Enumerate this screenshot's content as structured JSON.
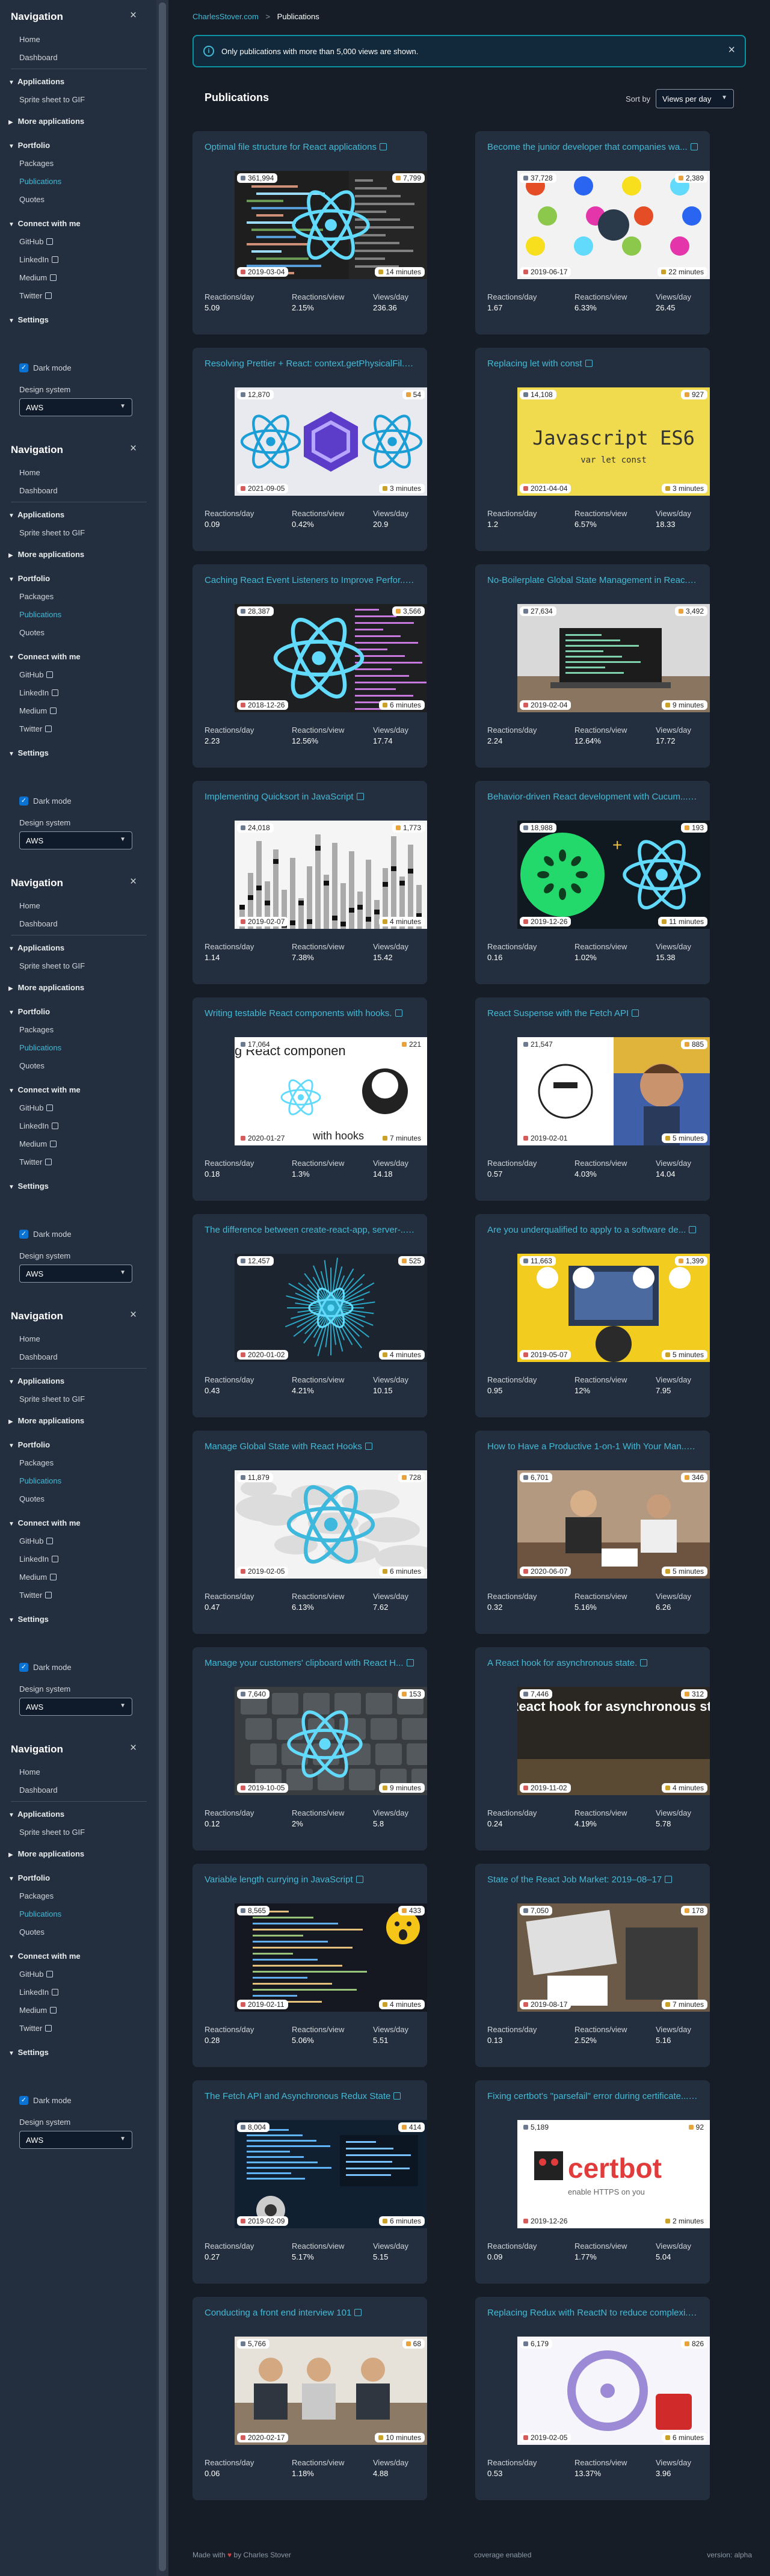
{
  "breadcrumb": {
    "site": "CharlesStover.com",
    "current": "Publications"
  },
  "flash": {
    "text": "Only publications with more than 5,000 views are shown.",
    "close": "×"
  },
  "header": {
    "title": "Publications",
    "sort_label": "Sort by",
    "sort_value": "Views per day"
  },
  "nav": {
    "title": "Navigation",
    "close": "×",
    "home": "Home",
    "dashboard": "Dashboard",
    "applications": "Applications",
    "sprite": "Sprite sheet to GIF",
    "more_apps": "More applications",
    "portfolio": "Portfolio",
    "packages": "Packages",
    "publications": "Publications",
    "quotes": "Quotes",
    "connect": "Connect with me",
    "github": "GitHub",
    "linkedin": "LinkedIn",
    "medium": "Medium",
    "twitter": "Twitter",
    "settings": "Settings",
    "dark_mode": "Dark mode",
    "design_system": "Design system",
    "design_value": "AWS"
  },
  "labels": {
    "per_day": "Reactions/day",
    "per_view": "Reactions/view",
    "views_day": "Views/day"
  },
  "cards": [
    {
      "title": "Optimal file structure for React applications",
      "views": "361,994",
      "reactions": "7,799",
      "date": "2019-03-04",
      "minutes": "14 minutes",
      "rpd": "5.09",
      "rpv": "2.15%",
      "vpd": "236.36",
      "art": "code"
    },
    {
      "title": "Become the junior developer that companies wa...",
      "views": "37,728",
      "reactions": "2,389",
      "date": "2019-06-17",
      "minutes": "22 minutes",
      "rpd": "1.67",
      "rpv": "6.33%",
      "vpd": "26.45",
      "art": "junior"
    },
    {
      "title": "Resolving Prettier + React: context.getPhysicalFil...",
      "views": "12,870",
      "reactions": "54",
      "date": "2021-09-05",
      "minutes": "3 minutes",
      "rpd": "0.09",
      "rpv": "0.42%",
      "vpd": "20.9",
      "art": "prettier"
    },
    {
      "title": "Replacing let with const",
      "views": "14,108",
      "reactions": "927",
      "date": "2021-04-04",
      "minutes": "3 minutes",
      "rpd": "1.2",
      "rpv": "6.57%",
      "vpd": "18.33",
      "art": "es6"
    },
    {
      "title": "Caching React Event Listeners to Improve Perfor...",
      "views": "28,387",
      "reactions": "3,566",
      "date": "2018-12-26",
      "minutes": "6 minutes",
      "rpd": "2.23",
      "rpv": "12.56%",
      "vpd": "17.74",
      "art": "caching"
    },
    {
      "title": "No-Boilerplate Global State Management in Reac...",
      "views": "27,634",
      "reactions": "3,492",
      "date": "2019-02-04",
      "minutes": "9 minutes",
      "rpd": "2.24",
      "rpv": "12.64%",
      "vpd": "17.72",
      "art": "laptop"
    },
    {
      "title": "Implementing Quicksort in JavaScript",
      "views": "24,018",
      "reactions": "1,773",
      "date": "2019-02-07",
      "minutes": "4 minutes",
      "rpd": "1.14",
      "rpv": "7.38%",
      "vpd": "15.42",
      "art": "quicksort"
    },
    {
      "title": "Behavior-driven React development with Cucum...",
      "views": "18,988",
      "reactions": "193",
      "date": "2019-12-26",
      "minutes": "11 minutes",
      "rpd": "0.16",
      "rpv": "1.02%",
      "vpd": "15.38",
      "art": "cucumber"
    },
    {
      "title": "Writing testable React components with hooks.",
      "views": "17,064",
      "reactions": "221",
      "date": "2020-01-27",
      "minutes": "7 minutes",
      "rpd": "0.18",
      "rpv": "1.3%",
      "vpd": "14.18",
      "art": "testable"
    },
    {
      "title": "React Suspense with the Fetch API",
      "views": "21,547",
      "reactions": "885",
      "date": "2019-02-01",
      "minutes": "5 minutes",
      "rpd": "0.57",
      "rpv": "4.03%",
      "vpd": "14.04",
      "art": "suspense"
    },
    {
      "title": "The difference between create-react-app, server-...",
      "views": "12,457",
      "reactions": "525",
      "date": "2020-01-02",
      "minutes": "4 minutes",
      "rpd": "0.43",
      "rpv": "4.21%",
      "vpd": "10.15",
      "art": "burst"
    },
    {
      "title": "Are you underqualified to apply to a software de...",
      "views": "11,663",
      "reactions": "1,399",
      "date": "2019-05-07",
      "minutes": "5 minutes",
      "rpd": "0.95",
      "rpv": "12%",
      "vpd": "7.95",
      "art": "underqual"
    },
    {
      "title": "Manage Global State with React Hooks",
      "views": "11,879",
      "reactions": "728",
      "date": "2019-02-05",
      "minutes": "6 minutes",
      "rpd": "0.47",
      "rpv": "6.13%",
      "vpd": "7.62",
      "art": "globe"
    },
    {
      "title": "How to Have a Productive 1-on-1 With Your Man...",
      "views": "6,701",
      "reactions": "346",
      "date": "2020-06-07",
      "minutes": "5 minutes",
      "rpd": "0.32",
      "rpv": "5.16%",
      "vpd": "6.26",
      "art": "meeting"
    },
    {
      "title": "Manage your customers' clipboard with React H...",
      "views": "7,640",
      "reactions": "153",
      "date": "2019-10-05",
      "minutes": "9 minutes",
      "rpd": "0.12",
      "rpv": "2%",
      "vpd": "5.8",
      "art": "keyboard"
    },
    {
      "title": "A React hook for asynchronous state.",
      "views": "7,446",
      "reactions": "312",
      "date": "2019-11-02",
      "minutes": "4 minutes",
      "rpd": "0.24",
      "rpv": "4.19%",
      "vpd": "5.78",
      "art": "hook",
      "overlay": "A React hook for asynchronous state"
    },
    {
      "title": "Variable length currying in JavaScript",
      "views": "8,565",
      "reactions": "433",
      "date": "2019-02-11",
      "minutes": "4 minutes",
      "rpd": "0.28",
      "rpv": "5.06%",
      "vpd": "5.51",
      "art": "currying"
    },
    {
      "title": "State of the React Job Market: 2019–08–17",
      "views": "7,050",
      "reactions": "178",
      "date": "2019-08-17",
      "minutes": "7 minutes",
      "rpd": "0.13",
      "rpv": "2.52%",
      "vpd": "5.16",
      "art": "desk"
    },
    {
      "title": "The Fetch API and Asynchronous Redux State",
      "views": "8,004",
      "reactions": "414",
      "date": "2019-02-09",
      "minutes": "6 minutes",
      "rpd": "0.27",
      "rpv": "5.17%",
      "vpd": "5.15",
      "art": "servers"
    },
    {
      "title": "Fixing certbot's \"parsefail\" error during certificate...",
      "views": "5,189",
      "reactions": "92",
      "date": "2019-12-26",
      "minutes": "2 minutes",
      "rpd": "0.09",
      "rpv": "1.77%",
      "vpd": "5.04",
      "art": "certbot",
      "logo": "certbot",
      "logo_sub": "enable HTTPS on you"
    },
    {
      "title": "Conducting a front end interview 101",
      "views": "5,766",
      "reactions": "68",
      "date": "2020-02-17",
      "minutes": "10 minutes",
      "rpd": "0.06",
      "rpv": "1.18%",
      "vpd": "4.88",
      "art": "interview"
    },
    {
      "title": "Replacing Redux with ReactN to reduce complexi...",
      "views": "6,179",
      "reactions": "826",
      "date": "2019-02-05",
      "minutes": "6 minutes",
      "rpd": "0.53",
      "rpv": "13.37%",
      "vpd": "3.96",
      "art": "redux"
    }
  ],
  "es6": {
    "title": "Javascript ES6",
    "sub": "var     let     const"
  },
  "testable_text": {
    "top": "g React componen",
    "bottom": "with hooks"
  },
  "footer": {
    "made": "Made with",
    "by": "by Charles Stover",
    "coverage": "coverage enabled",
    "version": "version: alpha"
  },
  "colors": {
    "accent": "#44b9d6",
    "card_bg": "#232f3e",
    "page_bg": "#161d26",
    "flash_border": "#0e93a5"
  }
}
